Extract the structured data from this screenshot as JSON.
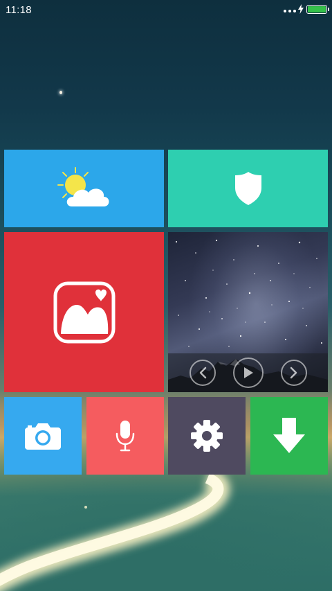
{
  "status_bar": {
    "time": "11:18",
    "battery_level": 1.0,
    "battery_color": "#35c14a",
    "icons": [
      "more-dots-icon",
      "charging-bolt-icon",
      "battery-icon"
    ]
  },
  "tiles": [
    {
      "name": "weather",
      "icon": "weather-sun-cloud-icon",
      "color": "#2ca7ea"
    },
    {
      "name": "security",
      "icon": "shield-icon",
      "color": "#2ecfb0"
    },
    {
      "name": "gallery",
      "icon": "gallery-heart-icon",
      "color": "#e0313a"
    },
    {
      "name": "photo-slideshow",
      "icon": "milky-way-photo",
      "controls": [
        "previous-icon",
        "play-icon",
        "next-icon"
      ]
    },
    {
      "name": "camera",
      "icon": "camera-icon",
      "color": "#36a9ef"
    },
    {
      "name": "voice-recorder",
      "icon": "microphone-icon",
      "color": "#f55c5f"
    },
    {
      "name": "settings",
      "icon": "gear-icon",
      "color": "#4f4a60"
    },
    {
      "name": "downloads",
      "icon": "download-arrow-icon",
      "color": "#2cb752"
    }
  ]
}
